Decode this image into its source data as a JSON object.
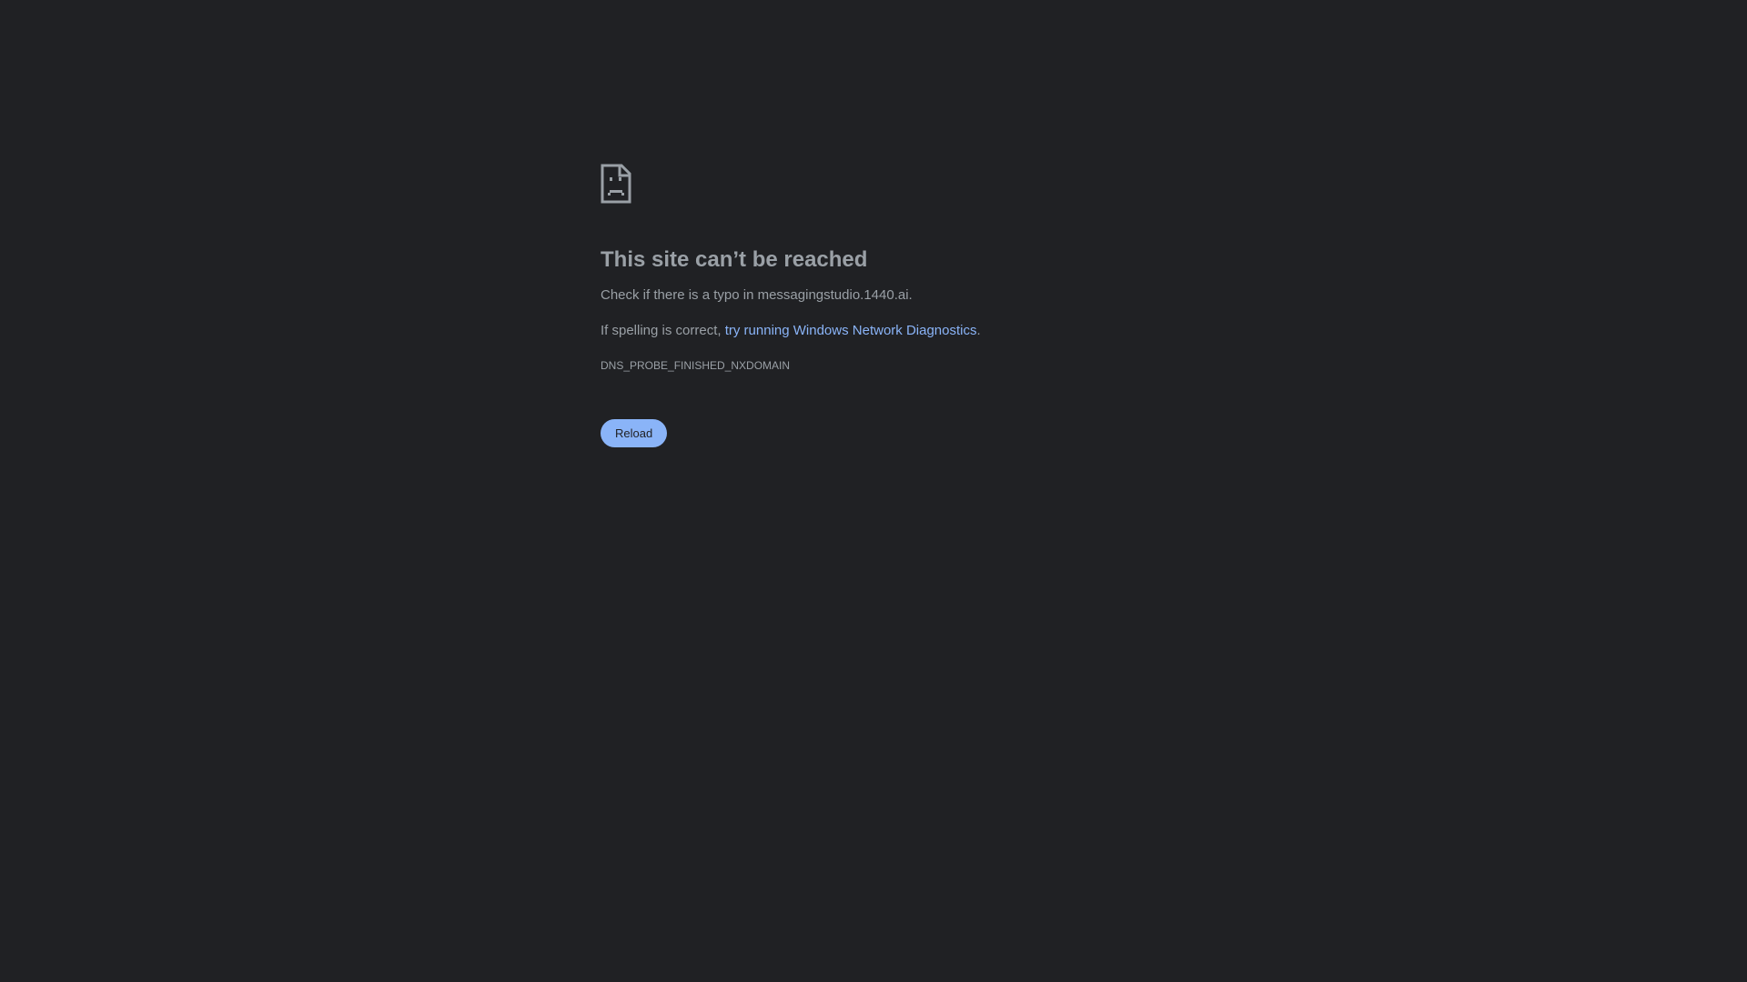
{
  "icon": "sad-page-icon",
  "title": "This site can’t be reached",
  "message_typo_prefix": "Check if there is a typo in ",
  "domain": "messagingstudio.1440.ai",
  "message_typo_suffix": ".",
  "message_spelling_prefix": "If spelling is correct, ",
  "diagnostics_link": "try running Windows Network Diagnostics",
  "message_spelling_suffix": ".",
  "error_code": "DNS_PROBE_FINISHED_NXDOMAIN",
  "reload_label": "Reload",
  "colors": {
    "background": "#202124",
    "text": "#9aa0a6",
    "link": "#8ab4f8",
    "button": "#8ab4f8"
  }
}
